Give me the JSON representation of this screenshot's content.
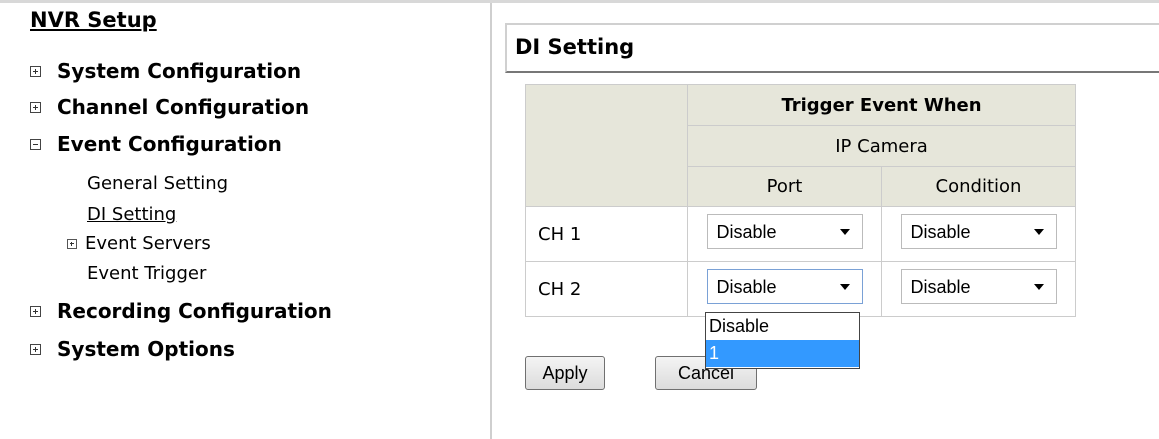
{
  "sidebar": {
    "title": "NVR Setup",
    "menu": [
      {
        "label": "System Configuration",
        "state": "collapsed"
      },
      {
        "label": "Channel Configuration",
        "state": "collapsed"
      },
      {
        "label": "Event Configuration",
        "state": "expanded",
        "children": [
          "General Setting",
          "DI Setting",
          "Event Servers",
          "Event Trigger"
        ]
      },
      {
        "label": "Recording Configuration",
        "state": "collapsed"
      },
      {
        "label": "System Options",
        "state": "collapsed"
      }
    ]
  },
  "main": {
    "title": "DI Setting",
    "table": {
      "header_trigger": "Trigger Event When",
      "header_source": "IP Camera",
      "col_port": "Port",
      "col_condition": "Condition",
      "rows": [
        {
          "channel": "CH 1",
          "port": "Disable",
          "condition": "Disable"
        },
        {
          "channel": "CH 2",
          "port": "Disable",
          "condition": "Disable"
        }
      ]
    },
    "dropdown": {
      "options": [
        "Disable",
        "1"
      ],
      "highlighted": "1"
    },
    "buttons": {
      "apply": "Apply",
      "cancel": "Cancel"
    }
  }
}
